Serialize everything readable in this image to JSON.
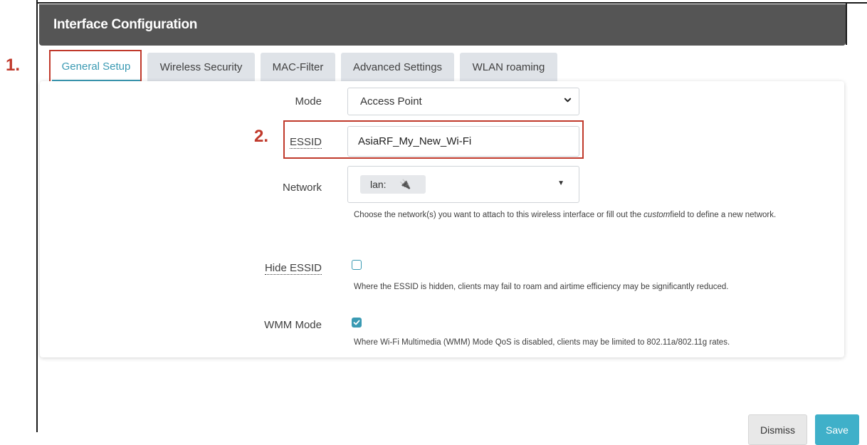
{
  "header": {
    "title": "Interface Configuration"
  },
  "steps": {
    "step1": "1.",
    "step2": "2."
  },
  "tabs": [
    {
      "label": "General Setup",
      "active": true
    },
    {
      "label": "Wireless Security",
      "active": false
    },
    {
      "label": "MAC-Filter",
      "active": false
    },
    {
      "label": "Advanced Settings",
      "active": false
    },
    {
      "label": "WLAN roaming",
      "active": false
    }
  ],
  "form": {
    "mode": {
      "label": "Mode",
      "value": "Access Point"
    },
    "essid": {
      "label": "ESSID",
      "value": "AsiaRF_My_New_Wi-Fi"
    },
    "network": {
      "label": "Network",
      "chip": "lan:",
      "help_before": "Choose the network(s) you want to attach to this wireless interface or fill out the ",
      "help_italic": "custom",
      "help_after": "field to define a new network."
    },
    "hide_essid": {
      "label": "Hide ESSID",
      "checked": false,
      "help": "Where the ESSID is hidden, clients may fail to roam and airtime efficiency may be significantly reduced."
    },
    "wmm": {
      "label": "WMM Mode",
      "checked": true,
      "help": "Where Wi-Fi Multimedia (WMM) Mode QoS is disabled, clients may be limited to 802.11a/802.11g rates."
    }
  },
  "footer": {
    "dismiss_label": "Dismiss",
    "save_label": "Save"
  },
  "colors": {
    "accent": "#3a9ab3",
    "annotation": "#c0392b",
    "header_bg": "#555555"
  }
}
